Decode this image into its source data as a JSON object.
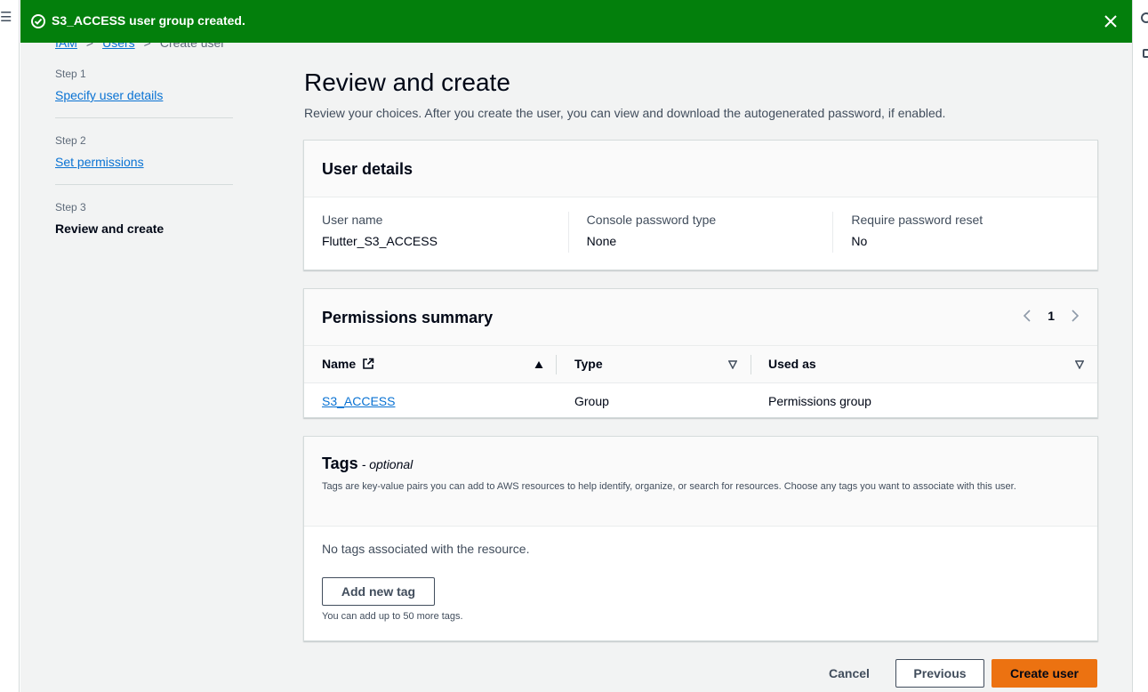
{
  "flash": {
    "message": "S3_ACCESS user group created.",
    "icon": "success-check-icon",
    "close_icon": "close-icon",
    "color": "#037f0c"
  },
  "breadcrumb": {
    "items": [
      "IAM",
      "Users",
      "Create user"
    ]
  },
  "steps": [
    {
      "number": "Step 1",
      "label": "Specify user details"
    },
    {
      "number": "Step 2",
      "label": "Set permissions"
    },
    {
      "number": "Step 3",
      "label": "Review and create"
    }
  ],
  "page": {
    "title": "Review and create",
    "description": "Review your choices. After you create the user, you can view and download the autogenerated password, if enabled."
  },
  "user_details": {
    "title": "User details",
    "fields": [
      {
        "label": "User name",
        "value": "Flutter_S3_ACCESS"
      },
      {
        "label": "Console password type",
        "value": "None"
      },
      {
        "label": "Require password reset",
        "value": "No"
      }
    ]
  },
  "permissions": {
    "title": "Permissions summary",
    "page": "1",
    "columns": [
      "Name",
      "Type",
      "Used as"
    ],
    "rows": [
      {
        "name": "S3_ACCESS",
        "type": "Group",
        "used_as": "Permissions group"
      }
    ]
  },
  "tags": {
    "title": "Tags",
    "optional": "- optional",
    "description": "Tags are key-value pairs you can add to AWS resources to help identify, organize, or search for resources. Choose any tags you want to associate with this user.",
    "empty": "No tags associated with the resource.",
    "add_button": "Add new tag",
    "note": "You can add up to 50 more tags."
  },
  "footer": {
    "cancel": "Cancel",
    "previous": "Previous",
    "create": "Create user",
    "primary_color": "#ec7211"
  }
}
